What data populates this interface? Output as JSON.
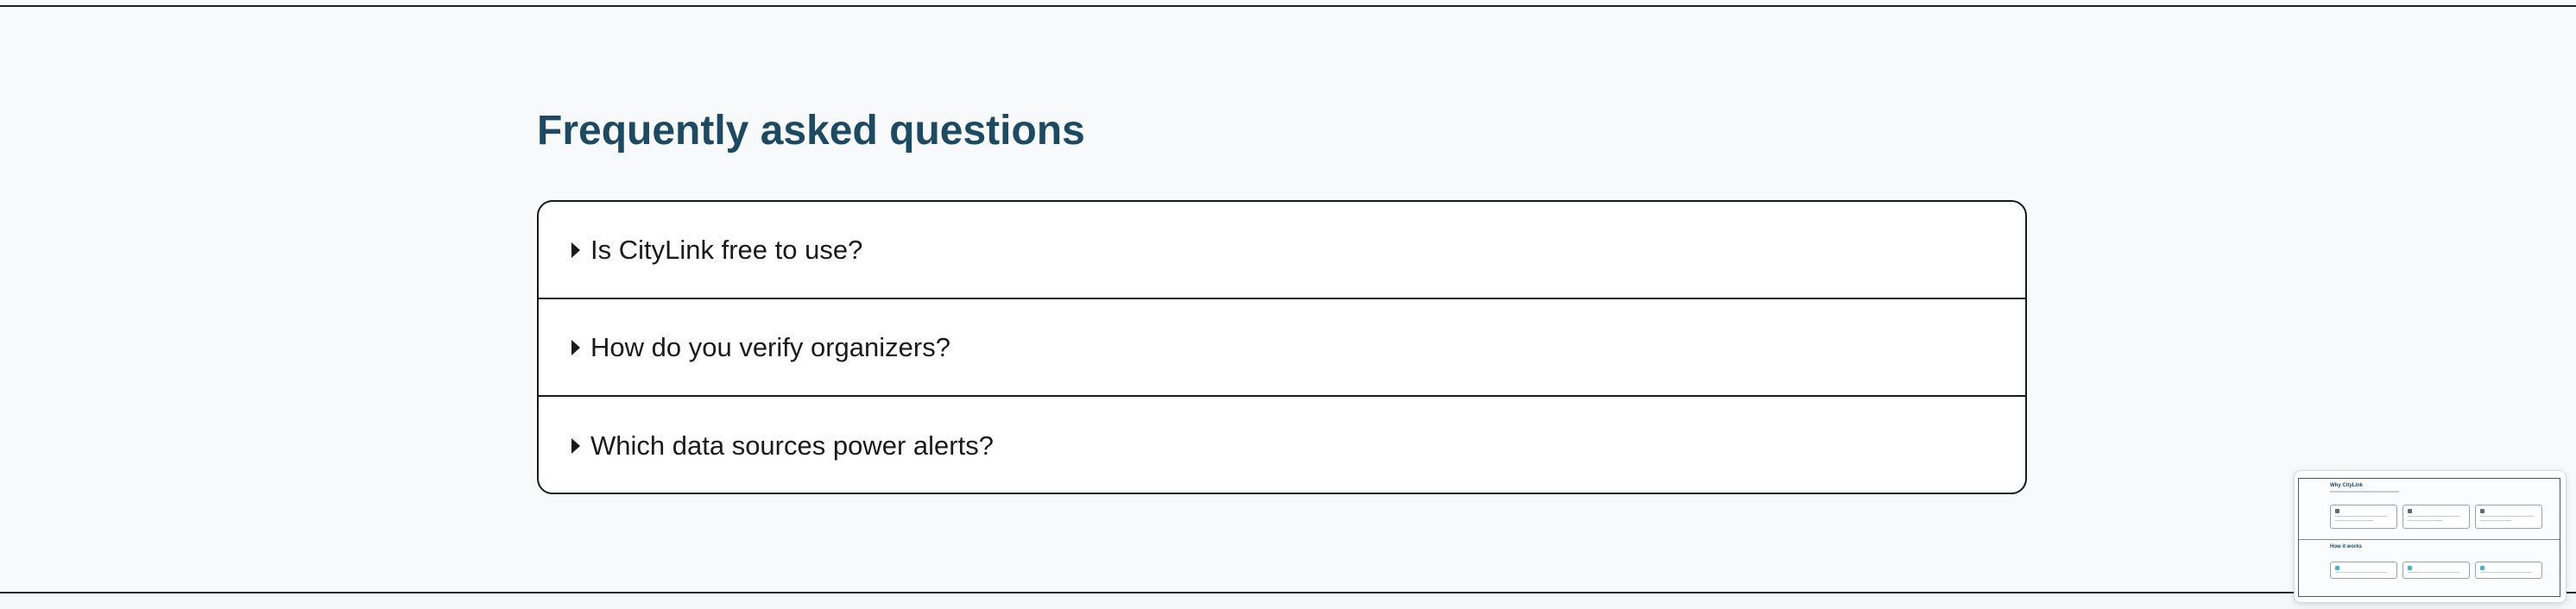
{
  "faq": {
    "title": "Frequently asked questions",
    "items": [
      {
        "question": "Is CityLink free to use?"
      },
      {
        "question": "How do you verify organizers?"
      },
      {
        "question": "Which data sources power alerts?"
      }
    ]
  },
  "minimap": {
    "section1_title": "Why CityLink",
    "section2_title": "How it works"
  }
}
